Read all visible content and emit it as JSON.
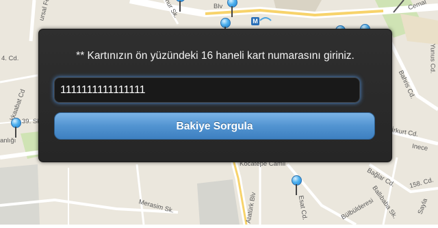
{
  "dialog": {
    "prompt": "** Kartınızın ön yüzündeki 16 haneli kart numarasını giriniz.",
    "card_number_value": "1111111111111111",
    "query_button_label": "Bakiye Sorgula"
  },
  "map": {
    "metro_badge": "M",
    "street_labels": [
      "Onur Sk.",
      "Cemal",
      "ursal Fe",
      "Blv",
      "4. Cd.",
      "kkaabat Cd",
      "39. Sk.",
      "anlığı",
      "Yunus Cd.",
      "Bahris Cd.",
      "İrkurt Cd.",
      "Inece",
      "Bağlar Cd.",
      "158. Cd.",
      "Ballıbaba Sk.",
      "Sayla",
      "Merasim Sk.",
      "Esat Cd.",
      "Atatürk Blv",
      "Bülbülderesi",
      "Kocatepe Camii"
    ]
  },
  "colors": {
    "dialog_bg": "#2b2b2b",
    "button_blue": "#5294d1",
    "input_glow": "#5096e6",
    "pin_blue": "#4fb1ee"
  }
}
